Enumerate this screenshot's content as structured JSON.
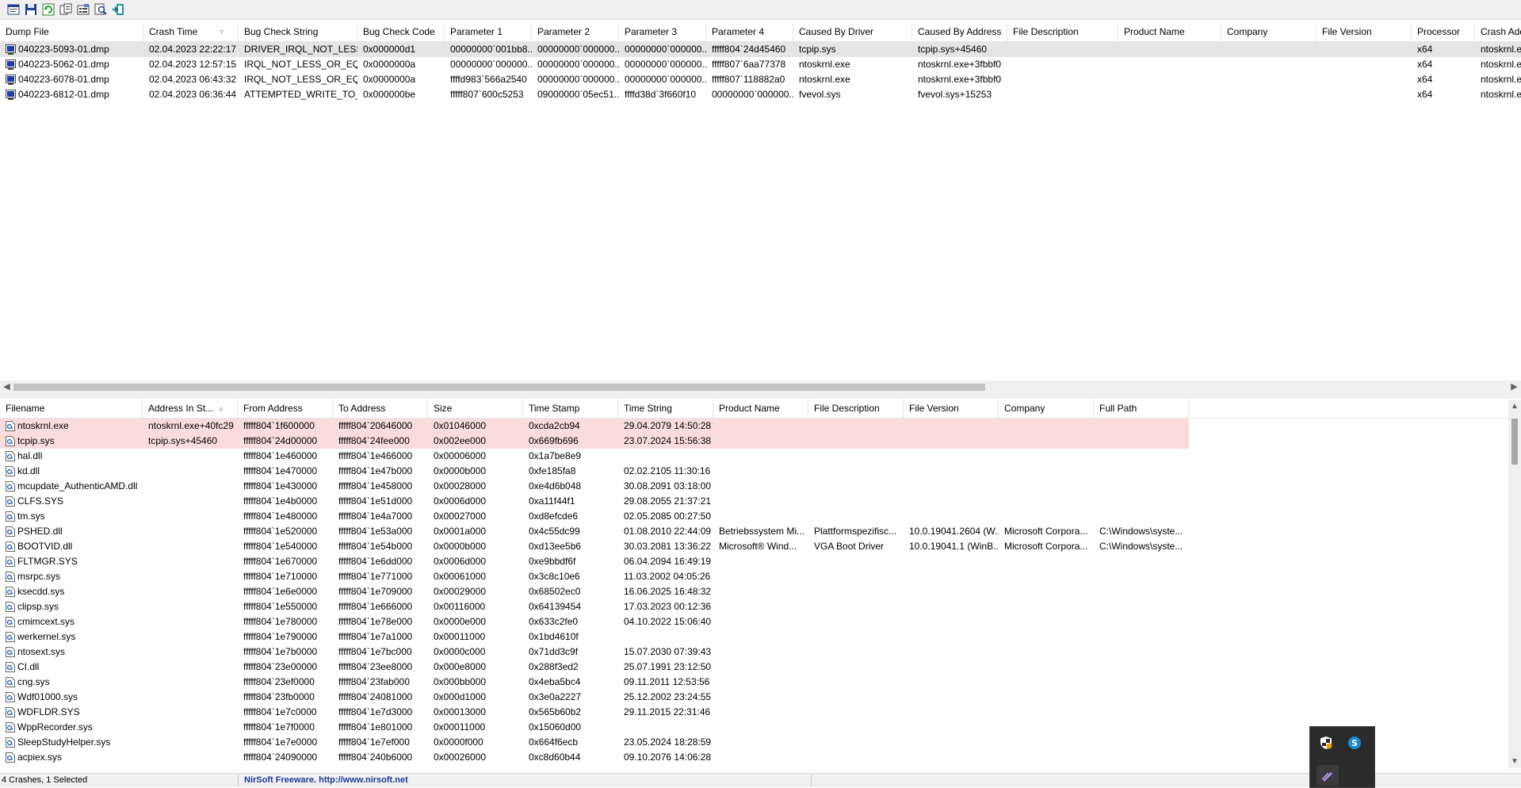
{
  "toolbar": {
    "buttons": [
      {
        "name": "html-report-icon",
        "title": "HTML Report"
      },
      {
        "name": "save-icon",
        "title": "Save Selected Items"
      },
      {
        "name": "refresh-icon",
        "title": "Refresh"
      },
      {
        "name": "copy-icon",
        "title": "Copy Selected Items"
      },
      {
        "name": "properties-icon",
        "title": "Properties"
      },
      {
        "name": "find-icon",
        "title": "Find"
      },
      {
        "name": "exit-icon",
        "title": "Exit"
      }
    ]
  },
  "crash_list": {
    "columns": [
      {
        "label": "Dump File",
        "w": 181
      },
      {
        "label": "Crash Time",
        "w": 120,
        "sort": "desc"
      },
      {
        "label": "Bug Check String",
        "w": 150
      },
      {
        "label": "Bug Check Code",
        "w": 110
      },
      {
        "label": "Parameter 1",
        "w": 110
      },
      {
        "label": "Parameter 2",
        "w": 110
      },
      {
        "label": "Parameter 3",
        "w": 110
      },
      {
        "label": "Parameter 4",
        "w": 110
      },
      {
        "label": "Caused By Driver",
        "w": 150
      },
      {
        "label": "Caused By Address",
        "w": 120
      },
      {
        "label": "File Description",
        "w": 140
      },
      {
        "label": "Product Name",
        "w": 130
      },
      {
        "label": "Company",
        "w": 120
      },
      {
        "label": "File Version",
        "w": 120
      },
      {
        "label": "Processor",
        "w": 80
      },
      {
        "label": "Crash Address",
        "w": 60
      }
    ],
    "rows": [
      [
        "040223-5093-01.dmp",
        "02.04.2023 22:22:17",
        "DRIVER_IRQL_NOT_LESS...",
        "0x000000d1",
        "00000000`001bb8...",
        "00000000`000000...",
        "00000000`000000...",
        "fffff804`24d45460",
        "tcpip.sys",
        "tcpip.sys+45460",
        "",
        "",
        "",
        "",
        "x64",
        "ntoskrnl.exe"
      ],
      [
        "040223-5062-01.dmp",
        "02.04.2023 12:57:15",
        "IRQL_NOT_LESS_OR_EQ...",
        "0x0000000a",
        "00000000`000000...",
        "00000000`000000...",
        "00000000`000000...",
        "fffff807`6aa77378",
        "ntoskrnl.exe",
        "ntoskrnl.exe+3fbbf0",
        "",
        "",
        "",
        "",
        "x64",
        "ntoskrnl.exe"
      ],
      [
        "040223-6078-01.dmp",
        "02.04.2023 06:43:32",
        "IRQL_NOT_LESS_OR_EQ...",
        "0x0000000a",
        "ffffd983`566a2540",
        "00000000`000000...",
        "00000000`000000...",
        "fffff807`118882a0",
        "ntoskrnl.exe",
        "ntoskrnl.exe+3fbbf0",
        "",
        "",
        "",
        "",
        "x64",
        "ntoskrnl.exe"
      ],
      [
        "040223-6812-01.dmp",
        "02.04.2023 06:36:44",
        "ATTEMPTED_WRITE_TO_...",
        "0x000000be",
        "fffff807`600c5253",
        "09000000`05ec51...",
        "ffffd38d`3f660f10",
        "00000000`000000...",
        "fvevol.sys",
        "fvevol.sys+15253",
        "",
        "",
        "",
        "",
        "x64",
        "ntoskrnl.exe"
      ]
    ],
    "selected_row": 0
  },
  "drivers_list": {
    "columns": [
      {
        "label": "Filename",
        "w": 180
      },
      {
        "label": "Address In St...",
        "w": 120,
        "sort": "asc"
      },
      {
        "label": "From Address",
        "w": 120
      },
      {
        "label": "To Address",
        "w": 120
      },
      {
        "label": "Size",
        "w": 120
      },
      {
        "label": "Time Stamp",
        "w": 120
      },
      {
        "label": "Time String",
        "w": 120
      },
      {
        "label": "Product Name",
        "w": 120
      },
      {
        "label": "File Description",
        "w": 120
      },
      {
        "label": "File Version",
        "w": 120
      },
      {
        "label": "Company",
        "w": 120
      },
      {
        "label": "Full Path",
        "w": 120
      }
    ],
    "rows": [
      [
        "ntoskrnl.exe",
        "ntoskrnl.exe+40fc29",
        "fffff804`1f600000",
        "fffff804`20646000",
        "0x01046000",
        "0xcda2cb94",
        "29.04.2079 14:50:28",
        "",
        "",
        "",
        "",
        ""
      ],
      [
        "tcpip.sys",
        "tcpip.sys+45460",
        "fffff804`24d00000",
        "fffff804`24fee000",
        "0x002ee000",
        "0x669fb696",
        "23.07.2024 15:56:38",
        "",
        "",
        "",
        "",
        ""
      ],
      [
        "hal.dll",
        "",
        "fffff804`1e460000",
        "fffff804`1e466000",
        "0x00006000",
        "0x1a7be8e9",
        "",
        "",
        "",
        "",
        "",
        ""
      ],
      [
        "kd.dll",
        "",
        "fffff804`1e470000",
        "fffff804`1e47b000",
        "0x0000b000",
        "0xfe185fa8",
        "02.02.2105 11:30:16",
        "",
        "",
        "",
        "",
        ""
      ],
      [
        "mcupdate_AuthenticAMD.dll",
        "",
        "fffff804`1e430000",
        "fffff804`1e458000",
        "0x00028000",
        "0xe4d6b048",
        "30.08.2091 03:18:00",
        "",
        "",
        "",
        "",
        ""
      ],
      [
        "CLFS.SYS",
        "",
        "fffff804`1e4b0000",
        "fffff804`1e51d000",
        "0x0006d000",
        "0xa11f44f1",
        "29.08.2055 21:37:21",
        "",
        "",
        "",
        "",
        ""
      ],
      [
        "tm.sys",
        "",
        "fffff804`1e480000",
        "fffff804`1e4a7000",
        "0x00027000",
        "0xd8efcde6",
        "02.05.2085 00:27:50",
        "",
        "",
        "",
        "",
        ""
      ],
      [
        "PSHED.dll",
        "",
        "fffff804`1e520000",
        "fffff804`1e53a000",
        "0x0001a000",
        "0x4c55dc99",
        "01.08.2010 22:44:09",
        "Betriebssystem Mi...",
        "Plattformspezifisc...",
        "10.0.19041.2604 (W...",
        "Microsoft Corpora...",
        "C:\\Windows\\syste..."
      ],
      [
        "BOOTVID.dll",
        "",
        "fffff804`1e540000",
        "fffff804`1e54b000",
        "0x0000b000",
        "0xd13ee5b6",
        "30.03.2081 13:36:22",
        "Microsoft® Wind...",
        "VGA Boot Driver",
        "10.0.19041.1 (WinB...",
        "Microsoft Corpora...",
        "C:\\Windows\\syste..."
      ],
      [
        "FLTMGR.SYS",
        "",
        "fffff804`1e670000",
        "fffff804`1e6dd000",
        "0x0006d000",
        "0xe9bbdf6f",
        "06.04.2094 16:49:19",
        "",
        "",
        "",
        "",
        ""
      ],
      [
        "msrpc.sys",
        "",
        "fffff804`1e710000",
        "fffff804`1e771000",
        "0x00061000",
        "0x3c8c10e6",
        "11.03.2002 04:05:26",
        "",
        "",
        "",
        "",
        ""
      ],
      [
        "ksecdd.sys",
        "",
        "fffff804`1e6e0000",
        "fffff804`1e709000",
        "0x00029000",
        "0x68502ec0",
        "16.06.2025 16:48:32",
        "",
        "",
        "",
        "",
        ""
      ],
      [
        "clipsp.sys",
        "",
        "fffff804`1e550000",
        "fffff804`1e666000",
        "0x00116000",
        "0x64139454",
        "17.03.2023 00:12:36",
        "",
        "",
        "",
        "",
        ""
      ],
      [
        "cmimcext.sys",
        "",
        "fffff804`1e780000",
        "fffff804`1e78e000",
        "0x0000e000",
        "0x633c2fe0",
        "04.10.2022 15:06:40",
        "",
        "",
        "",
        "",
        ""
      ],
      [
        "werkernel.sys",
        "",
        "fffff804`1e790000",
        "fffff804`1e7a1000",
        "0x00011000",
        "0x1bd4610f",
        "",
        "",
        "",
        "",
        "",
        ""
      ],
      [
        "ntosext.sys",
        "",
        "fffff804`1e7b0000",
        "fffff804`1e7bc000",
        "0x0000c000",
        "0x71dd3c9f",
        "15.07.2030 07:39:43",
        "",
        "",
        "",
        "",
        ""
      ],
      [
        "CI.dll",
        "",
        "fffff804`23e00000",
        "fffff804`23ee8000",
        "0x000e8000",
        "0x288f3ed2",
        "25.07.1991 23:12:50",
        "",
        "",
        "",
        "",
        ""
      ],
      [
        "cng.sys",
        "",
        "fffff804`23ef0000",
        "fffff804`23fab000",
        "0x000bb000",
        "0x4eba5bc4",
        "09.11.2011 12:53:56",
        "",
        "",
        "",
        "",
        ""
      ],
      [
        "Wdf01000.sys",
        "",
        "fffff804`23fb0000",
        "fffff804`24081000",
        "0x000d1000",
        "0x3e0a2227",
        "25.12.2002 23:24:55",
        "",
        "",
        "",
        "",
        ""
      ],
      [
        "WDFLDR.SYS",
        "",
        "fffff804`1e7c0000",
        "fffff804`1e7d3000",
        "0x00013000",
        "0x565b60b2",
        "29.11.2015 22:31:46",
        "",
        "",
        "",
        "",
        ""
      ],
      [
        "WppRecorder.sys",
        "",
        "fffff804`1e7f0000",
        "fffff804`1e801000",
        "0x00011000",
        "0x15060d00",
        "",
        "",
        "",
        "",
        "",
        ""
      ],
      [
        "SleepStudyHelper.sys",
        "",
        "fffff804`1e7e0000",
        "fffff804`1e7ef000",
        "0x0000f000",
        "0x664f6ecb",
        "23.05.2024 18:28:59",
        "",
        "",
        "",
        "",
        ""
      ],
      [
        "acpiex.sys",
        "",
        "fffff804`24090000",
        "fffff804`240b6000",
        "0x00026000",
        "0xc8d60b44",
        "09.10.2076 14:06:28",
        "",
        "",
        "",
        "",
        ""
      ]
    ],
    "highlighted_rows": [
      0,
      1
    ]
  },
  "status": {
    "crashes": "4 Crashes, 1 Selected",
    "freeware": "NirSoft Freeware.  http://www.nirsoft.net"
  },
  "tray": {
    "icons": [
      "security-shield-icon",
      "skype-icon",
      "pen-icon"
    ]
  },
  "colors": {
    "highlight_row": "#fadcdc",
    "selected_row": "#e5e5e5",
    "link": "#1c3a9c"
  }
}
